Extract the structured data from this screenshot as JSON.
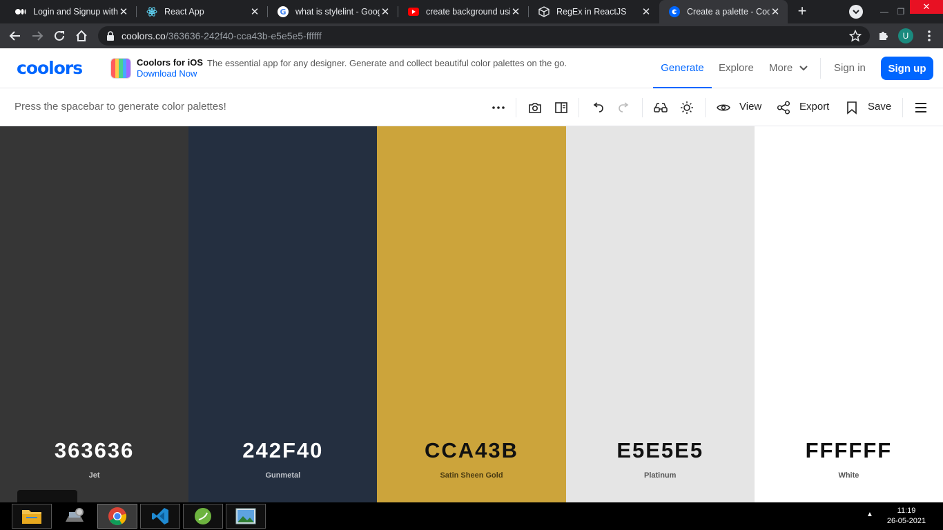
{
  "browser": {
    "tabs": [
      {
        "title": "Login and Signup with",
        "icon": "medium-icon"
      },
      {
        "title": "React App",
        "icon": "react-icon"
      },
      {
        "title": "what is stylelint - Googl",
        "icon": "google-icon"
      },
      {
        "title": "create background usin",
        "icon": "youtube-icon"
      },
      {
        "title": "RegEx in ReactJS",
        "icon": "codesandbox-icon"
      },
      {
        "title": "Create a palette - Coolo",
        "icon": "coolors-icon",
        "active": true
      }
    ],
    "url_host": "coolors.co",
    "url_path": "/363636-242f40-cca43b-e5e5e5-ffffff",
    "profile_initial": "U"
  },
  "header": {
    "logo": "coolors",
    "promo": {
      "title": "Coolors for iOS",
      "text": "The essential app for any designer. Generate and collect beautiful color palettes on the go.",
      "link": "Download Now"
    },
    "nav": {
      "generate": "Generate",
      "explore": "Explore",
      "more": "More",
      "signin": "Sign in",
      "signup": "Sign up"
    }
  },
  "toolbar": {
    "hint": "Press the spacebar to generate color palettes!",
    "view": "View",
    "export": "Export",
    "save": "Save"
  },
  "palette": [
    {
      "hex": "363636",
      "name": "Jet",
      "color": "#363636",
      "text_color": "#ffffff",
      "name_color": "#c8c8c8"
    },
    {
      "hex": "242F40",
      "name": "Gunmetal",
      "color": "#242f40",
      "text_color": "#ffffff",
      "name_color": "#c2c6cc"
    },
    {
      "hex": "CCA43B",
      "name": "Satin Sheen Gold",
      "color": "#cca43b",
      "text_color": "#111111",
      "name_color": "#4a3b12"
    },
    {
      "hex": "E5E5E5",
      "name": "Platinum",
      "color": "#e5e5e5",
      "text_color": "#111111",
      "name_color": "#555555"
    },
    {
      "hex": "FFFFFF",
      "name": "White",
      "color": "#ffffff",
      "text_color": "#111111",
      "name_color": "#555555"
    }
  ],
  "taskbar": {
    "time": "11:19",
    "date": "26-05-2021"
  },
  "colors": {
    "brand": "#0066ff",
    "chrome_dark": "#202124",
    "chrome_tab": "#35363a"
  }
}
